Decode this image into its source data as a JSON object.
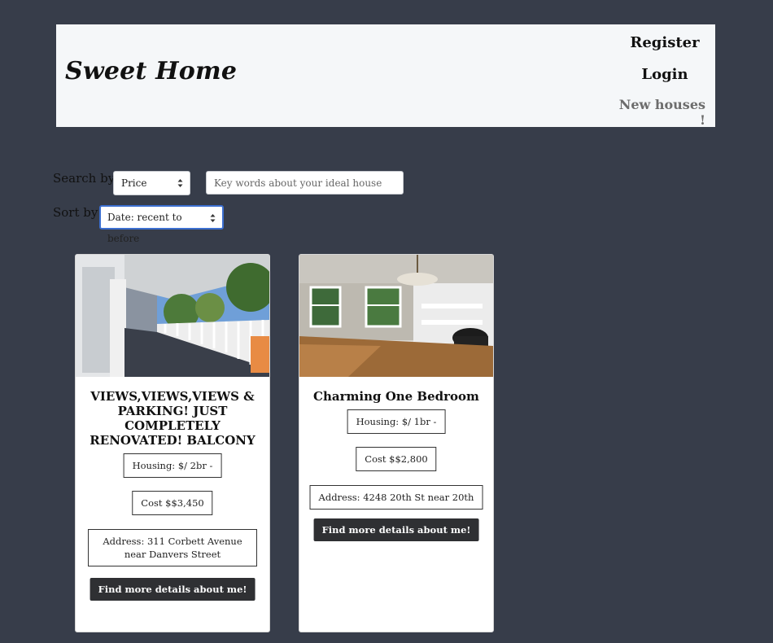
{
  "header": {
    "brand": "Sweet Home",
    "nav": {
      "register": "Register",
      "login": "Login",
      "new_houses": "New houses !"
    }
  },
  "filters": {
    "search_label": "Search by",
    "search_select_value": "Price",
    "search_placeholder": "Key words about your ideal house",
    "sort_label": "Sort by",
    "sort_select_value": "Date: recent to before"
  },
  "listings": [
    {
      "title": "VIEWS,VIEWS,VIEWS & PARKING! JUST COMPLETELY RENOVATED! BALCONY",
      "housing": "Housing: $/ 2br -",
      "cost": "Cost $$3,450",
      "address": "Address: 311 Corbett Avenue near Danvers Street",
      "button": "Find more details about me!"
    },
    {
      "title": "Charming One Bedroom",
      "housing": "Housing: $/ 1br -",
      "cost": "Cost $$2,800",
      "address": "Address: 4248 20th St near 20th",
      "button": "Find more details about me!"
    }
  ],
  "icons": {
    "select_arrows": "updown-chevron-icon"
  },
  "colors": {
    "page_bg": "#373d4a",
    "header_bg": "#f5f7f9",
    "button_bg": "#2f3033",
    "focus_border": "#3c6fd0"
  }
}
